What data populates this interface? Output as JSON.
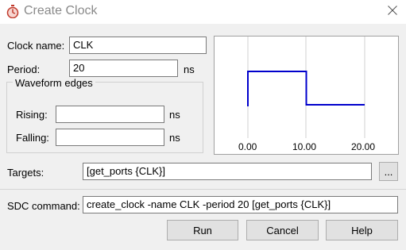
{
  "window": {
    "title": "Create Clock"
  },
  "form": {
    "clock_name_label": "Clock name:",
    "clock_name_value": "CLK",
    "period_label": "Period:",
    "period_value": "20",
    "period_unit": "ns",
    "waveform_group_title": "Waveform edges",
    "rising_label": "Rising:",
    "rising_value": "",
    "rising_unit": "ns",
    "falling_label": "Falling:",
    "falling_value": "",
    "falling_unit": "ns",
    "targets_label": "Targets:",
    "targets_value": "[get_ports {CLK}]",
    "browse_label": "...",
    "sdc_label": "SDC command:",
    "sdc_value": "create_clock -name CLK -period 20 [get_ports {CLK}]"
  },
  "waveform": {
    "tick_labels": [
      "0.00",
      "10.00",
      "20.00"
    ],
    "period": 20,
    "rising_edge": 0,
    "falling_edge": 10,
    "wave_color": "#0000cc"
  },
  "buttons": {
    "run": "Run",
    "cancel": "Cancel",
    "help": "Help"
  }
}
